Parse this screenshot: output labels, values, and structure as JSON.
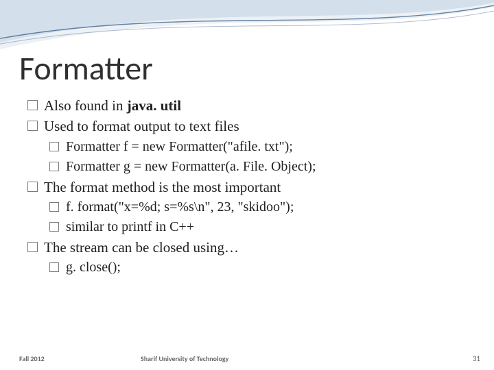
{
  "title": "Formatter",
  "bullets": {
    "b1_pre": "Also found in ",
    "b1_bold": "java. util",
    "b2": "Used to format output to text files",
    "b2s1": "Formatter f = new Formatter(\"afile. txt\");",
    "b2s2": "Formatter g = new Formatter(a. File. Object);",
    "b3": "The format method is the most important",
    "b3s1": "f. format(\"x=%d; s=%s\\n\", 23, \"skidoo\");",
    "b3s2": "similar to printf in C++",
    "b4": "The stream can be closed using…",
    "b4s1": "g. close();"
  },
  "footer": {
    "left": "Fall 2012",
    "center": "Sharif University of Technology",
    "page": "31"
  }
}
